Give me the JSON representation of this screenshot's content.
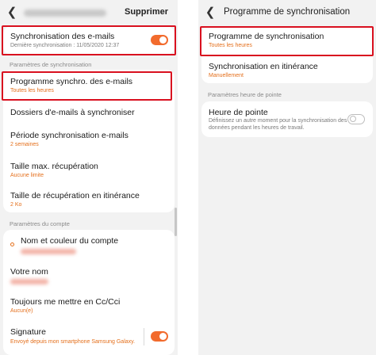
{
  "left": {
    "header": {
      "back_icon": "chevron-left-icon",
      "action_label": "Supprimer"
    },
    "sync_emails": {
      "title": "Synchronisation des e-mails",
      "subtitle": "Dernière synchronisation : 11/05/2020  12:37",
      "toggle_on": true
    },
    "section_sync_params": "Paramètres de synchronisation",
    "items": [
      {
        "title": "Programme synchro. des e-mails",
        "subtitle": "Toutes les heures"
      },
      {
        "title": "Dossiers d'e-mails à synchroniser",
        "subtitle": ""
      },
      {
        "title": "Période synchronisation e-mails",
        "subtitle": "2 semaines"
      },
      {
        "title": "Taille max. récupération",
        "subtitle": "Aucune limite"
      },
      {
        "title": "Taille de récupération en itinérance",
        "subtitle": "2 Ko"
      }
    ],
    "section_account_params": "Paramètres du compte",
    "account_items": [
      {
        "title": "Nom et couleur du compte"
      },
      {
        "title": "Votre nom"
      },
      {
        "title": "Toujours me mettre en Cc/Cci",
        "subtitle": "Aucun(e)"
      },
      {
        "title": "Signature",
        "subtitle": "Envoyé depuis mon smartphone Samsung Galaxy.",
        "toggle_on": true
      }
    ]
  },
  "right": {
    "header": {
      "back_icon": "chevron-left-icon",
      "title": "Programme de synchronisation"
    },
    "items": [
      {
        "title": "Programme de synchronisation",
        "subtitle": "Toutes les heures"
      },
      {
        "title": "Synchronisation en itinérance",
        "subtitle": "Manuellement"
      }
    ],
    "section_peak": "Paramètres heure de pointe",
    "peak": {
      "title": "Heure de pointe",
      "description": "Définissez un autre moment pour la synchronisation des données pendant les heures de travail.",
      "toggle_on": false
    }
  },
  "colors": {
    "accent": "#f26b2d",
    "highlight": "#d9101f",
    "background": "#f2f2f2"
  }
}
